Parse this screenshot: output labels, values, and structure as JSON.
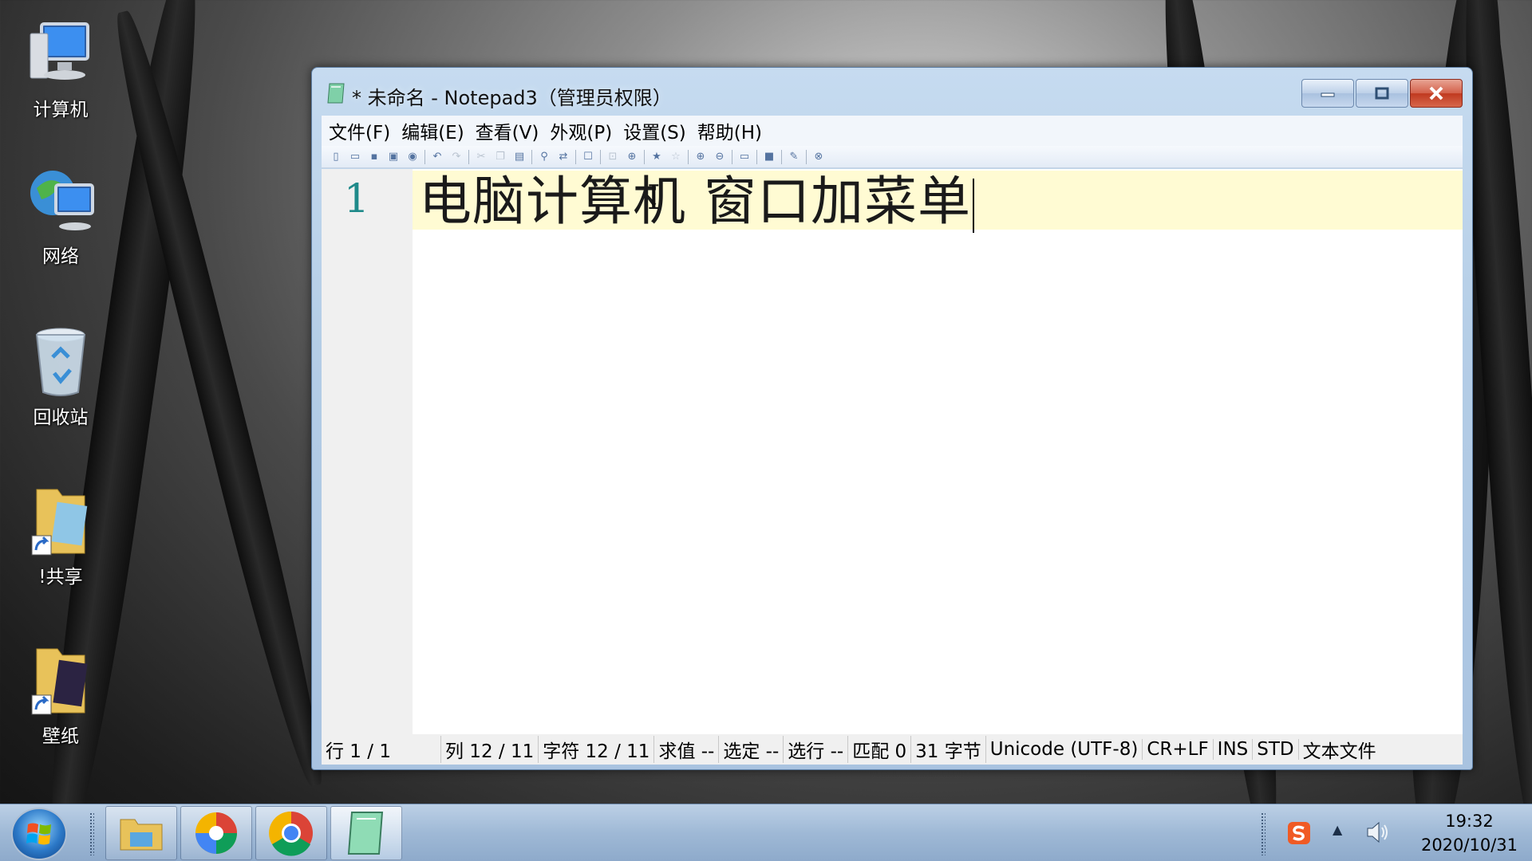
{
  "desktop": {
    "icons": [
      {
        "label": "计算机"
      },
      {
        "label": "网络"
      },
      {
        "label": "回收站"
      },
      {
        "label": "!共享"
      },
      {
        "label": "壁纸"
      }
    ]
  },
  "window": {
    "title": "* 未命名 - Notepad3（管理员权限）",
    "menu": [
      "文件(F)",
      "编辑(E)",
      "查看(V)",
      "外观(P)",
      "设置(S)",
      "帮助(H)"
    ],
    "editor": {
      "line_number": "1",
      "text": "电脑计算机 窗口加菜单"
    },
    "status": {
      "line": "行 1 / 1",
      "col": "列 12 / 11",
      "chars": "字符 12 / 11",
      "eval": "求值 --",
      "sel": "选定 --",
      "sel_lines": "选行 --",
      "match": "匹配 0",
      "bytes": "31 字节",
      "encoding": "Unicode (UTF-8)",
      "eol": "CR+LF",
      "ins": "INS",
      "mode": "STD",
      "filetype": "文本文件"
    }
  },
  "taskbar": {
    "clock_time": "19:32",
    "clock_date": "2020/10/31"
  }
}
